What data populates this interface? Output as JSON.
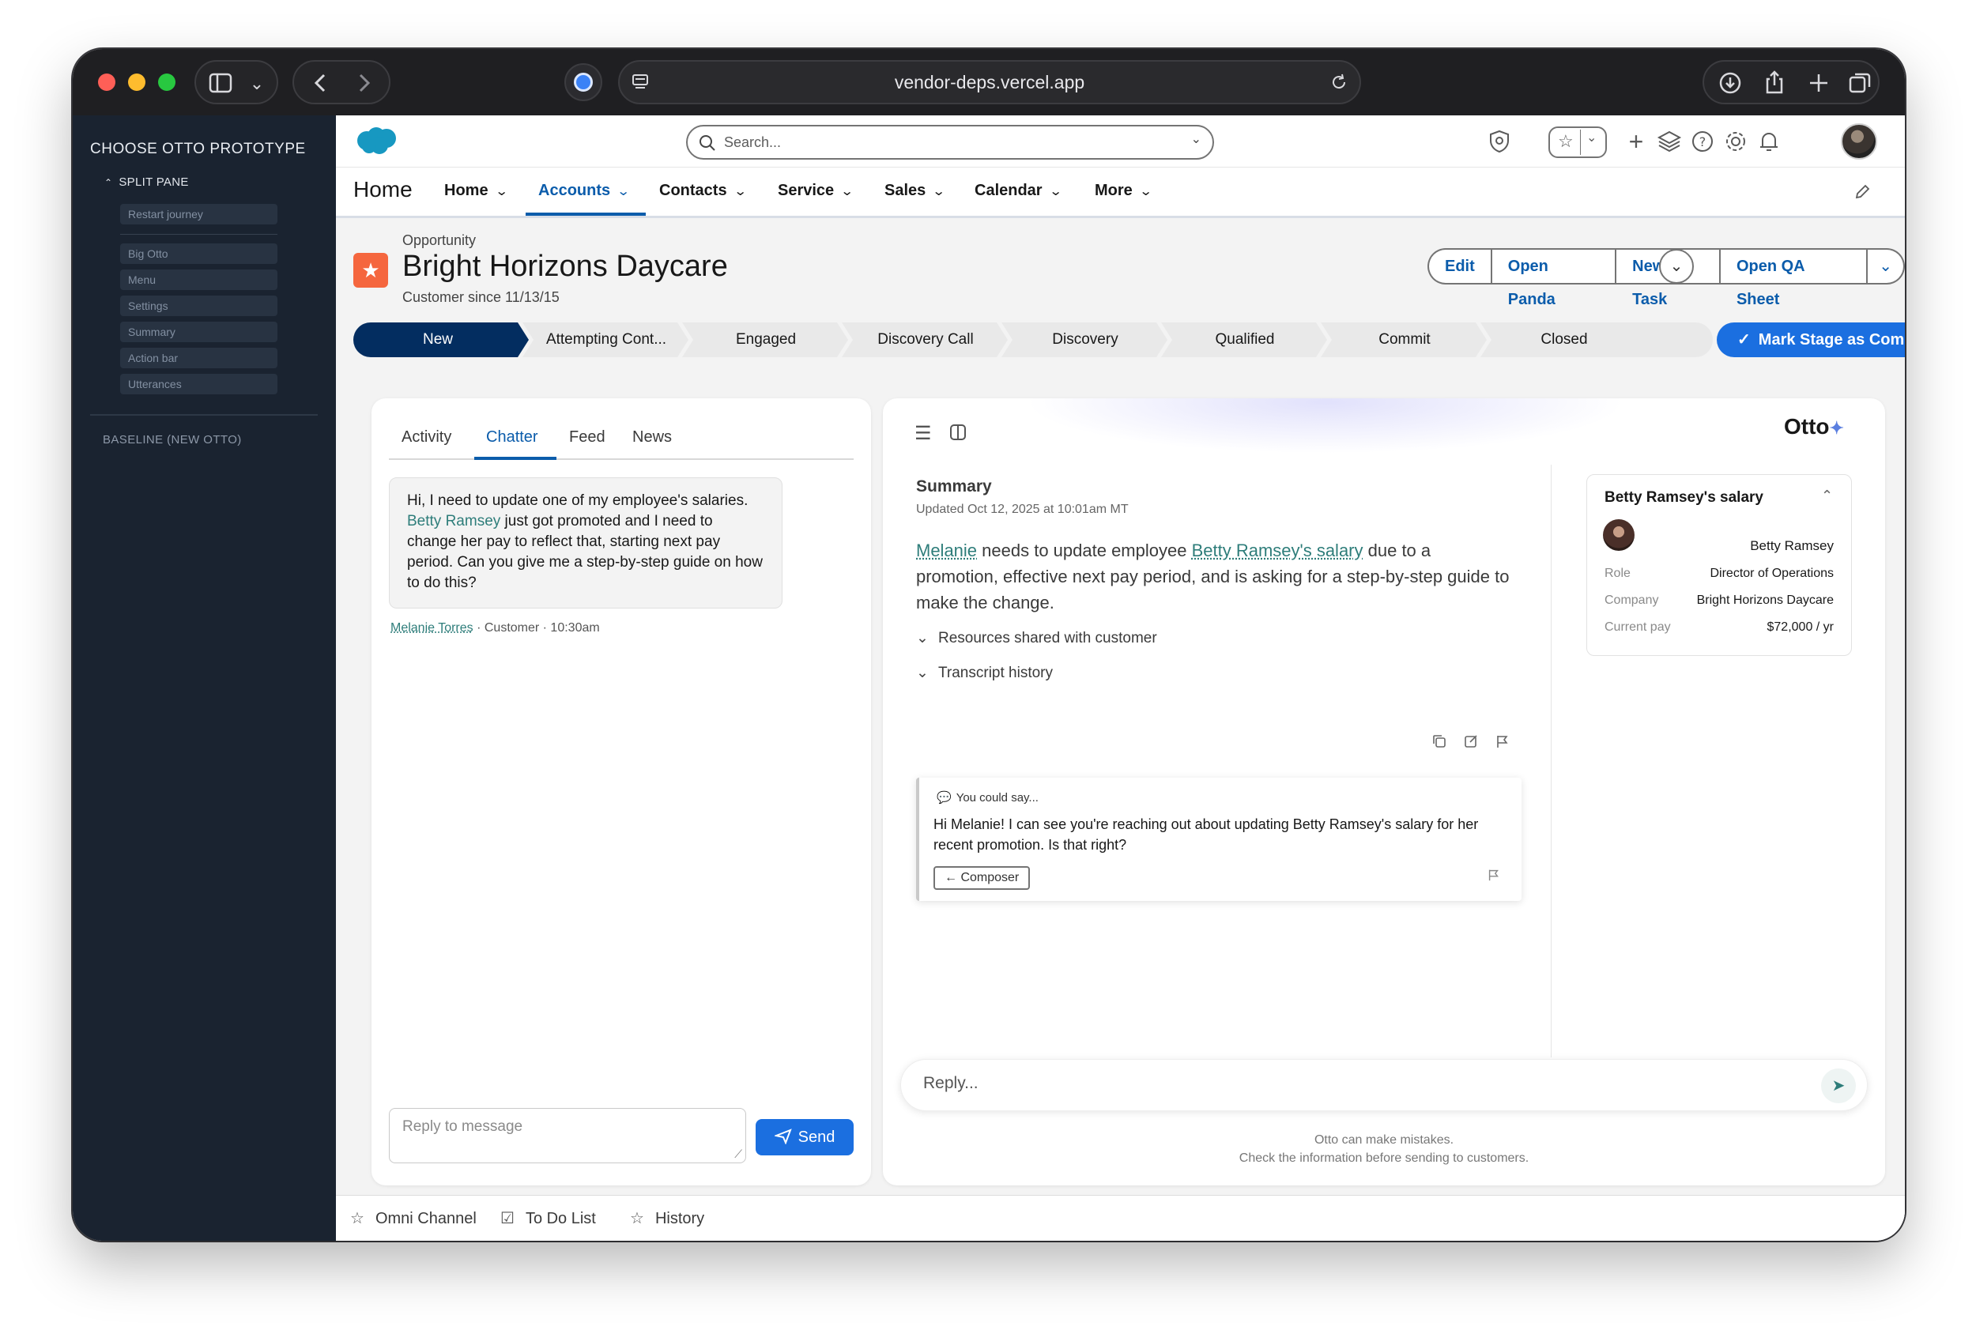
{
  "browser": {
    "url": "vendor-deps.vercel.app"
  },
  "prototype_panel": {
    "title": "CHOOSE OTTO PROTOTYPE",
    "section": "SPLIT PANE",
    "restart": "Restart journey",
    "items": [
      "Big Otto",
      "Menu",
      "Settings",
      "Summary",
      "Action bar",
      "Utterances"
    ],
    "baseline": "BASELINE (NEW OTTO)"
  },
  "topbar": {
    "search_placeholder": "Search..."
  },
  "nav": {
    "app_name": "Home",
    "items": [
      {
        "label": "Home"
      },
      {
        "label": "Accounts",
        "active": true
      },
      {
        "label": "Contacts"
      },
      {
        "label": "Service"
      },
      {
        "label": "Sales"
      },
      {
        "label": "Calendar"
      },
      {
        "label": "More"
      }
    ]
  },
  "record": {
    "type": "Opportunity",
    "name": "Bright Horizons Daycare",
    "since": "Customer since 11/13/15",
    "actions": [
      "Edit",
      "Open Panda",
      "New Task",
      "Open QA Sheet"
    ]
  },
  "path": {
    "stages": [
      "New",
      "Attempting Cont...",
      "Engaged",
      "Discovery Call",
      "Discovery",
      "Qualified",
      "Commit",
      "Closed"
    ],
    "current": "New",
    "mark_button": "Mark Stage as Complete"
  },
  "chatter": {
    "tabs": [
      "Activity",
      "Chatter",
      "Feed",
      "News"
    ],
    "active_tab": "Chatter",
    "message": {
      "pre": "Hi, I need to update one of my employee's salaries. ",
      "mention": "Betty Ramsey",
      "post": " just got promoted and I need to change her pay to reflect that, starting next pay period. Can you give me a step-by-step guide on how to do this?",
      "author": "Melanie Torres",
      "meta": " · Customer · 10:30am"
    },
    "reply_placeholder": "Reply to message",
    "send_label": "Send"
  },
  "otto": {
    "brand": "Otto",
    "summary_title": "Summary",
    "updated": "Updated Oct 12, 2025 at 10:01am MT",
    "summary": {
      "name": "Melanie",
      "part1": " needs to update employee ",
      "link": "Betty Ramsey's salary",
      "part2": " due to a promotion, effective next pay period, and is asking for a step-by-step guide to make the change."
    },
    "accordions": [
      "Resources shared with customer",
      "Transcript history"
    ],
    "suggestion": {
      "label": "You could say...",
      "text": "Hi Melanie! I can see you're reaching out about updating Betty Ramsey's salary for her recent promotion. Is that right?",
      "composer": "← Composer"
    },
    "contact": {
      "title": "Betty Ramsey's salary",
      "name": "Betty Ramsey",
      "rows": [
        {
          "key": "Role",
          "value": "Director of Operations"
        },
        {
          "key": "Company",
          "value": "Bright Horizons Daycare"
        },
        {
          "key": "Current pay",
          "value": "$72,000 / yr"
        }
      ]
    },
    "reply_placeholder": "Reply...",
    "disclaimer_1": "Otto can make mistakes.",
    "disclaimer_2": "Check the information before sending to customers."
  },
  "utility": {
    "items": [
      "Omni Channel",
      "To Do List",
      "History"
    ]
  },
  "colors": {
    "brand_blue": "#0b5cab",
    "path_active": "#032d60",
    "button_blue": "#1b6fe0",
    "link_teal": "#2e7d7a",
    "record_icon": "#f5663e"
  }
}
